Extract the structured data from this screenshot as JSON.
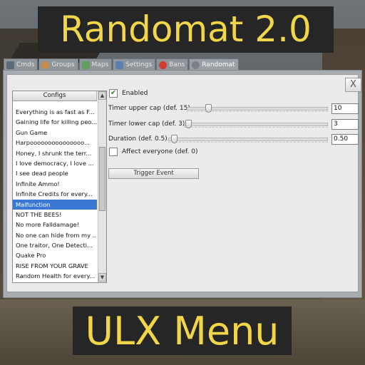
{
  "banners": {
    "top": "Randomat 2.0",
    "bottom": "ULX Menu"
  },
  "tabs": [
    {
      "label": "Cmds",
      "icon": "terminal-icon"
    },
    {
      "label": "Groups",
      "icon": "group-icon"
    },
    {
      "label": "Maps",
      "icon": "map-icon"
    },
    {
      "label": "Settings",
      "icon": "wrench-icon"
    },
    {
      "label": "Bans",
      "icon": "stop-icon"
    },
    {
      "label": "Randomat",
      "icon": "gear-icon",
      "active": true
    }
  ],
  "close_label": "X",
  "list": {
    "header": "Configs",
    "items": [
      "Everything is as fast as F...",
      "Gaining life for killing peo...",
      "Gun Game",
      "Harpooooooooooooooo...",
      "Honey, I shrunk the terr...",
      "I love democracy, I love ...",
      "I see dead people",
      "Infinite Ammo!",
      "Infinite Credits for every...",
      "Malfunction",
      "NOT THE BEES!",
      "No more Falldamage!",
      "No one can hide from my ...",
      "One traitor, One Detecti...",
      "Quake Pro",
      "RISE FROM YOUR GRAVE",
      "Random Health for every..."
    ],
    "selected": "Malfunction"
  },
  "controls": {
    "enabled_label": "Enabled",
    "enabled_checked": true,
    "upper_cap_label": "Timer upper cap (def. 15)",
    "upper_cap_value": "10",
    "lower_cap_label": "Timer lower cap (def. 3)",
    "lower_cap_value": "3",
    "duration_label": "Duration (def. 0.5)",
    "duration_value": "0.50",
    "affect_label": "Affect everyone (def. 0)",
    "affect_checked": false,
    "trigger_label": "Trigger Event"
  },
  "colors": {
    "banner_text": "#f1d64a",
    "banner_bg": "#262626",
    "selection": "#3b78d4"
  }
}
